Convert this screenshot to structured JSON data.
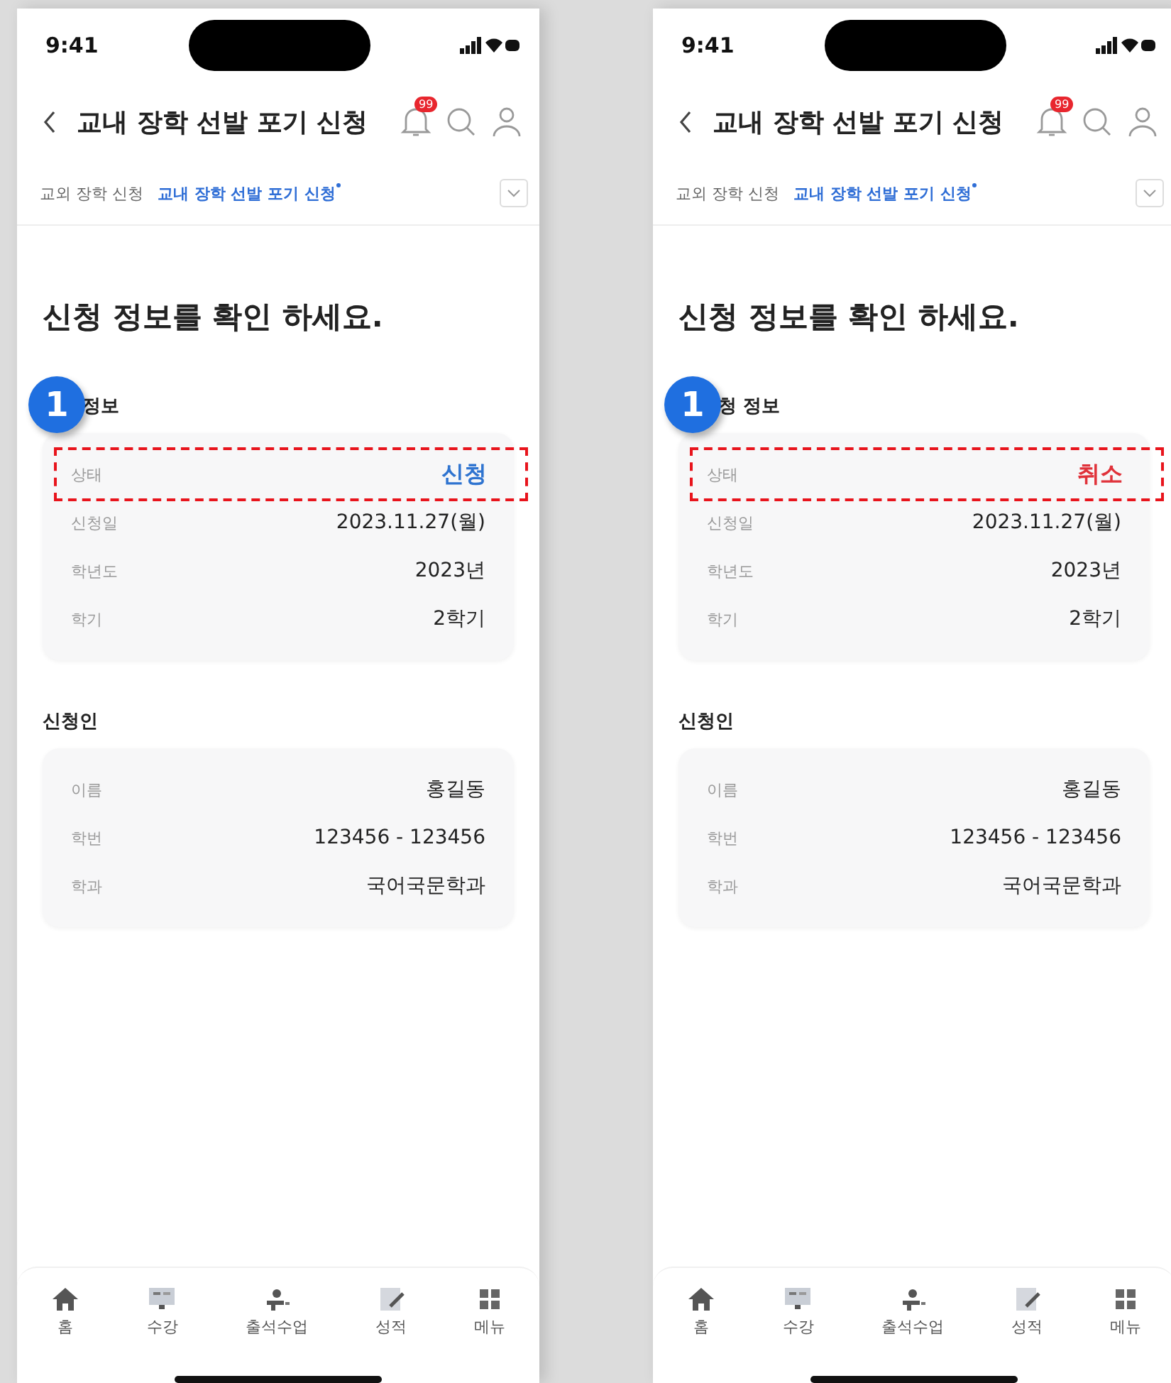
{
  "screens": [
    {
      "status_bar": {
        "time": "9:41"
      },
      "header": {
        "title": "교내 장학 선발 포기 신청",
        "notification_count": "99"
      },
      "breadcrumb": [
        {
          "label": "교외 장학 신청",
          "selected": false
        },
        {
          "label": "교내 장학 선발 포기 신청",
          "selected": true
        }
      ],
      "heading": "신청 정보를 확인 하세요.",
      "callout": "1",
      "sections": [
        {
          "title": "정보",
          "rows": [
            {
              "label": "상태",
              "value": "신청",
              "highlighted": true,
              "color": "#2f74d0"
            },
            {
              "label": "신청일",
              "value": "2023.11.27(월)",
              "highlighted": false
            },
            {
              "label": "학년도",
              "value": "2023년",
              "highlighted": false
            },
            {
              "label": "학기",
              "value": "2학기",
              "highlighted": false
            }
          ]
        },
        {
          "title": "신청인",
          "rows": [
            {
              "label": "이름",
              "value": "홍길동",
              "highlighted": false
            },
            {
              "label": "학번",
              "value": "123456 - 123456",
              "highlighted": false
            },
            {
              "label": "학과",
              "value": "국어국문학과",
              "highlighted": false
            }
          ]
        }
      ],
      "nav": [
        {
          "kind": "home",
          "label": "홈"
        },
        {
          "kind": "course",
          "label": "수강"
        },
        {
          "kind": "attend",
          "label": "출석수업"
        },
        {
          "kind": "grade",
          "label": "성적"
        },
        {
          "kind": "menu",
          "label": "메뉴"
        }
      ]
    },
    {
      "status_bar": {
        "time": "9:41"
      },
      "header": {
        "title": "교내 장학 선발 포기 신청",
        "notification_count": "99"
      },
      "breadcrumb": [
        {
          "label": "교외 장학 신청",
          "selected": false
        },
        {
          "label": "교내 장학 선발 포기 신청",
          "selected": true
        }
      ],
      "heading": "신청 정보를 확인 하세요.",
      "callout": "1",
      "sections": [
        {
          "title": "청 정보",
          "rows": [
            {
              "label": "상태",
              "value": "취소",
              "highlighted": true,
              "color": "#e0323a"
            },
            {
              "label": "신청일",
              "value": "2023.11.27(월)",
              "highlighted": false
            },
            {
              "label": "학년도",
              "value": "2023년",
              "highlighted": false
            },
            {
              "label": "학기",
              "value": "2학기",
              "highlighted": false
            }
          ]
        },
        {
          "title": "신청인",
          "rows": [
            {
              "label": "이름",
              "value": "홍길동",
              "highlighted": false
            },
            {
              "label": "학번",
              "value": "123456 - 123456",
              "highlighted": false
            },
            {
              "label": "학과",
              "value": "국어국문학과",
              "highlighted": false
            }
          ]
        }
      ],
      "nav": [
        {
          "kind": "home",
          "label": "홈"
        },
        {
          "kind": "course",
          "label": "수강"
        },
        {
          "kind": "attend",
          "label": "출석수업"
        },
        {
          "kind": "grade",
          "label": "성적"
        },
        {
          "kind": "menu",
          "label": "메뉴"
        }
      ]
    }
  ]
}
